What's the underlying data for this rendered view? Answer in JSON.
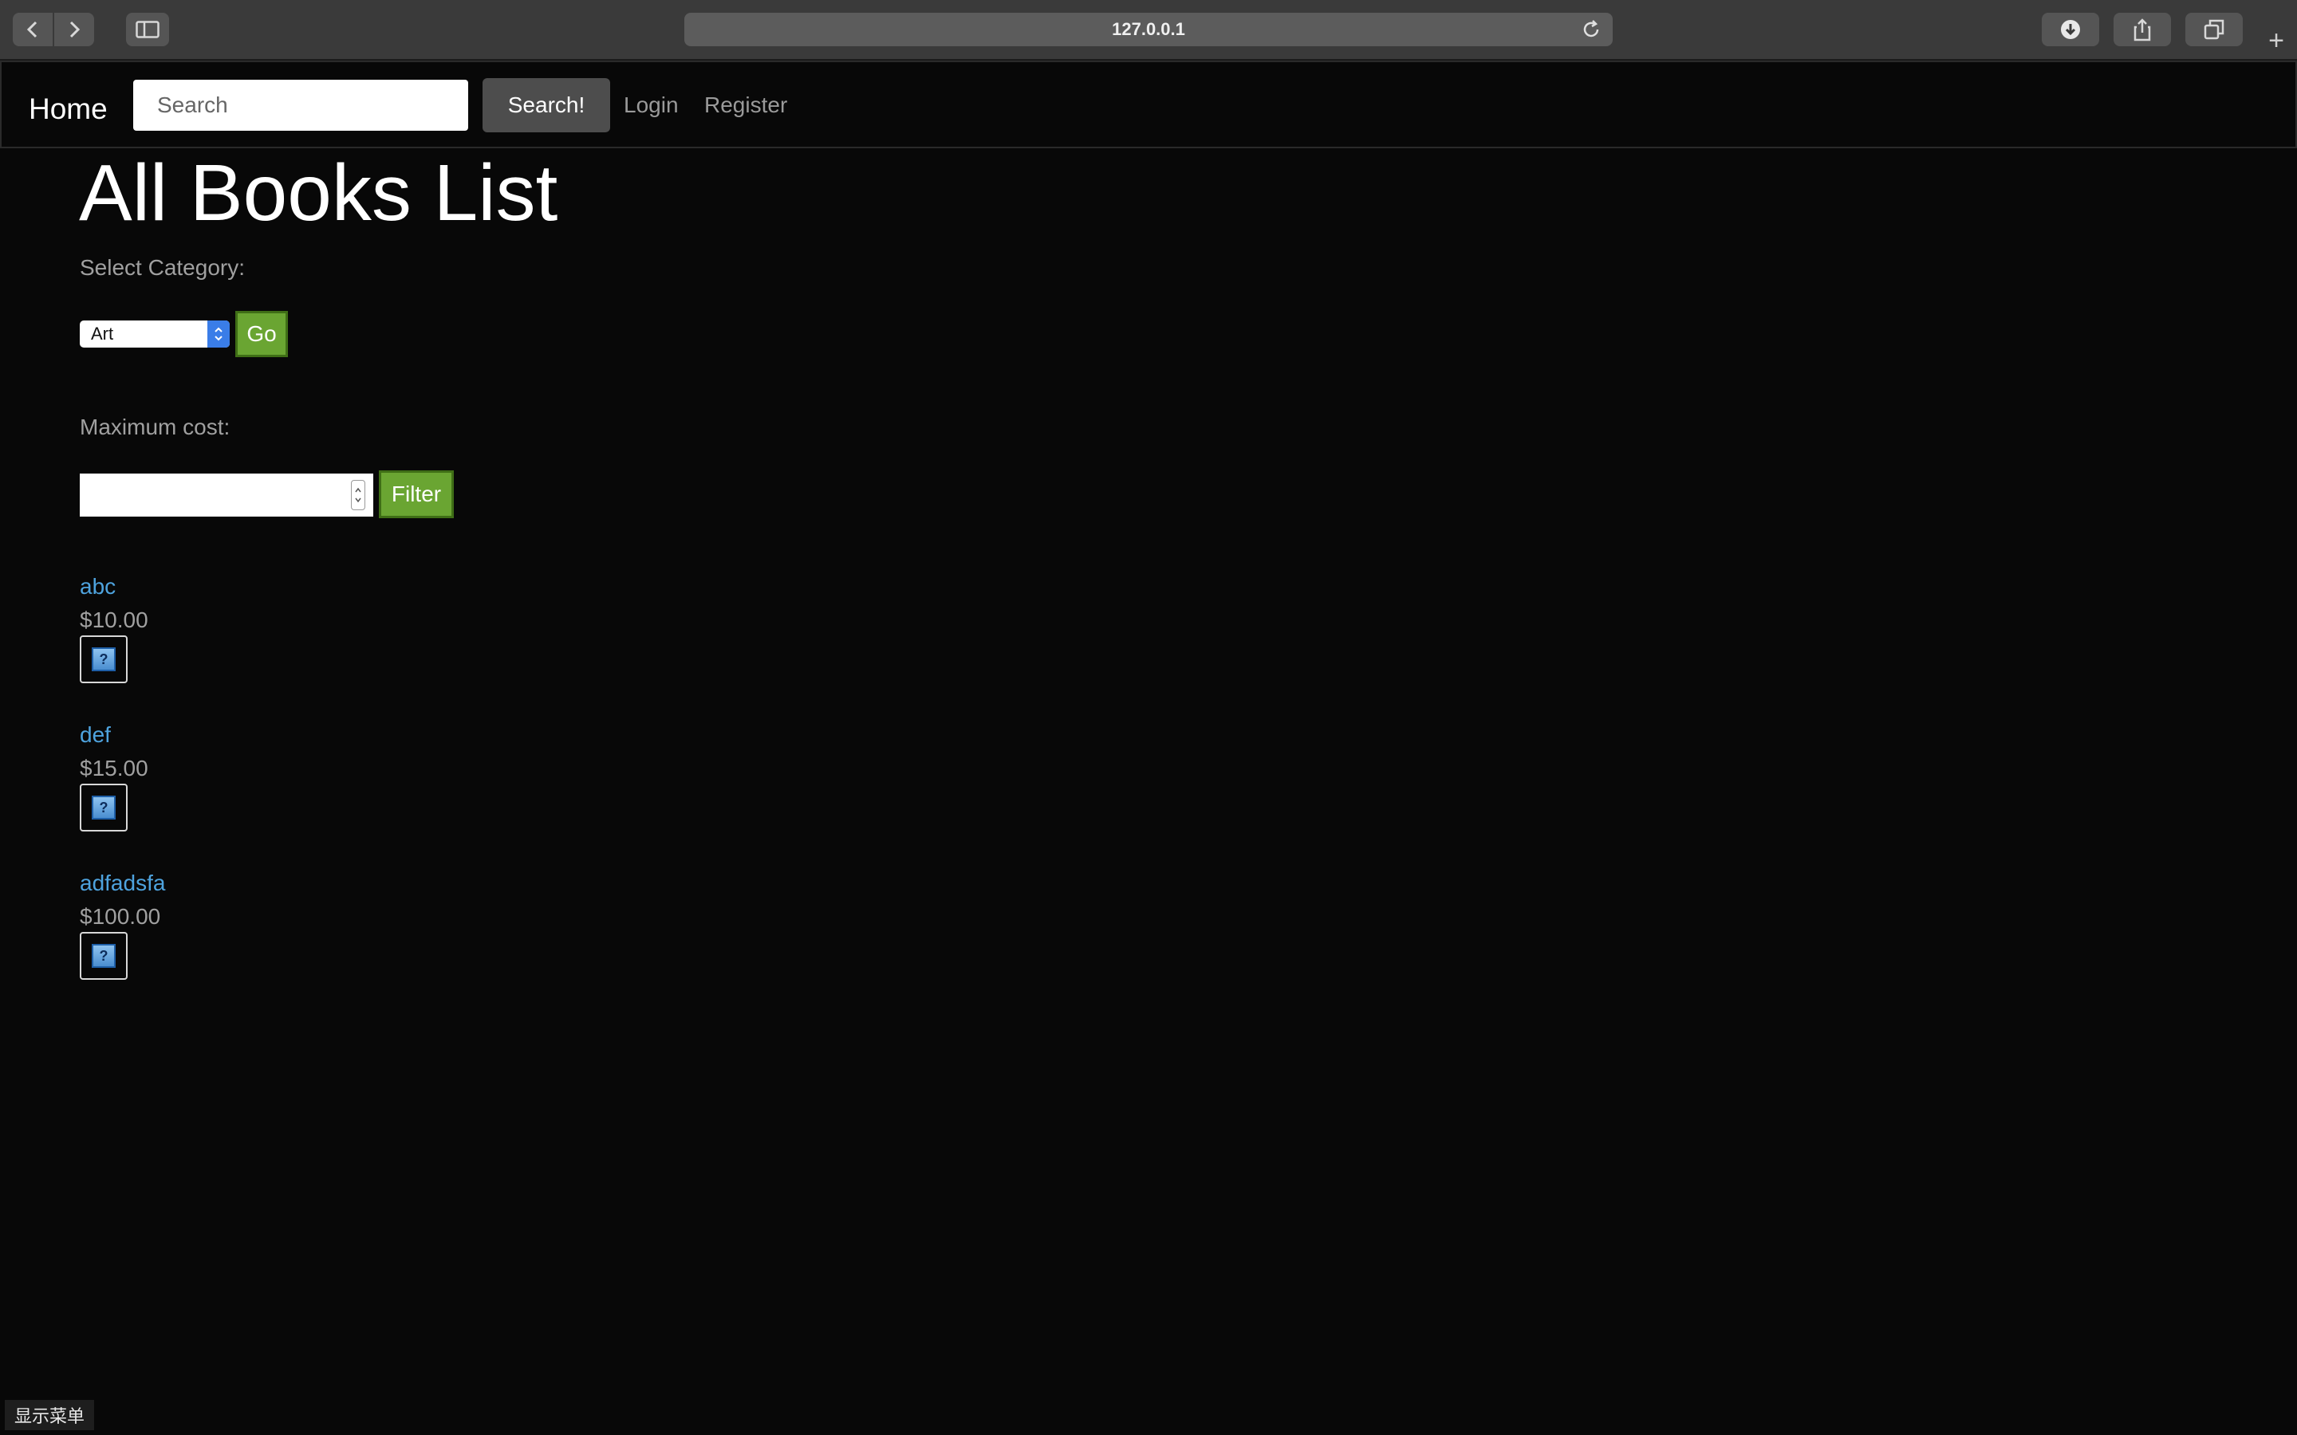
{
  "browser": {
    "url": "127.0.0.1",
    "icons": {
      "back": "chevron-left-icon",
      "forward": "chevron-right-icon",
      "sidebar": "sidebar-icon",
      "reload": "reload-icon",
      "download": "download-icon",
      "share": "share-icon",
      "tabs": "tabs-icon",
      "new_tab": "plus-icon"
    },
    "new_tab_glyph": "+"
  },
  "navbar": {
    "brand": "Home",
    "search_placeholder": "Search",
    "search_button": "Search!",
    "login": "Login",
    "register": "Register"
  },
  "page": {
    "title": "All Books List",
    "category_label": "Select Category:",
    "category_selected": "Art",
    "go_button": "Go",
    "cost_label": "Maximum cost:",
    "cost_value": "",
    "filter_button": "Filter"
  },
  "books": [
    {
      "title": "abc",
      "price": "$10.00",
      "image_icon": "broken-image-icon",
      "image_glyph": "?"
    },
    {
      "title": "def",
      "price": "$15.00",
      "image_icon": "broken-image-icon",
      "image_glyph": "?"
    },
    {
      "title": "adfadsfa",
      "price": "$100.00",
      "image_icon": "broken-image-icon",
      "image_glyph": "?"
    }
  ],
  "footer": {
    "menu_button": "显示菜单"
  },
  "colors": {
    "background": "#080808",
    "link": "#4ea3de",
    "accent_button": "#6aa532",
    "muted_text": "#a0a0a0"
  }
}
